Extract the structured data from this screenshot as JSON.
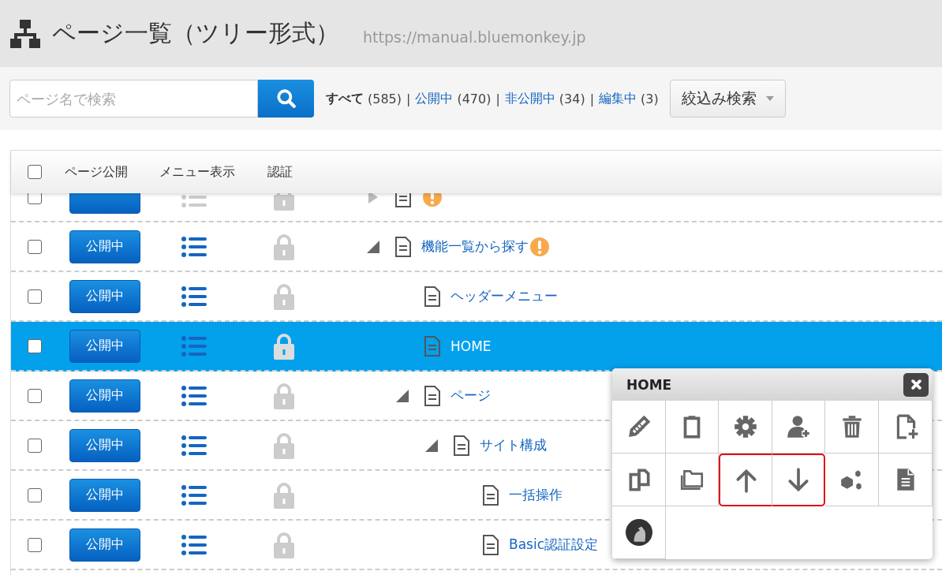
{
  "window": {
    "title": "ページ一覧（ツリー形式）",
    "url": "https://manual.bluemonkey.jp"
  },
  "search": {
    "placeholder": "ページ名で検索"
  },
  "filters": [
    {
      "label": "すべて",
      "count": "(585)",
      "selected": true
    },
    {
      "separator": "|",
      "label": "公開中",
      "count": "(470)",
      "selected": false
    },
    {
      "separator": "|",
      "label": "非公開中",
      "count": "(34)",
      "selected": false
    },
    {
      "separator": "|",
      "label": "編集中",
      "count": "(3)",
      "selected": false
    }
  ],
  "filter_dropdown": {
    "label": "絞込み検索"
  },
  "table": {
    "columns": [
      "ページ公開",
      "メニュー表示",
      "認証"
    ],
    "header_checked": false,
    "rows": [
      {
        "checked": false,
        "menu_shown": false,
        "selected": false,
        "warning": true,
        "expanded": false
      },
      {
        "title": "機能一覧から探す",
        "status": "公開中",
        "checked": false,
        "menu_shown": true,
        "selected": false,
        "warning": true,
        "expanded": true,
        "children": [
          {
            "title": "ヘッダーメニュー",
            "status": "公開中",
            "checked": false,
            "menu_shown": true,
            "selected": false,
            "warning": false
          },
          {
            "title": "HOME",
            "status": "公開中",
            "checked": false,
            "menu_shown": true,
            "selected": true,
            "warning": false
          },
          {
            "title": "ページ",
            "status": "公開中",
            "checked": false,
            "menu_shown": true,
            "selected": false,
            "warning": false,
            "expanded": true,
            "children": [
              {
                "title": "サイト構成",
                "status": "公開中",
                "checked": false,
                "menu_shown": true,
                "selected": false,
                "warning": false,
                "expanded": true,
                "children": [
                  {
                    "title": "一括操作",
                    "status": "公開中",
                    "checked": false,
                    "menu_shown": true,
                    "selected": false,
                    "warning": false
                  },
                  {
                    "title": "Basic認証設定",
                    "status": "公開中",
                    "checked": false,
                    "menu_shown": true,
                    "selected": false,
                    "warning": false
                  }
                ]
              }
            ]
          }
        ]
      }
    ]
  },
  "popup": {
    "title": "HOME",
    "actions": [
      {
        "kind": "pencil",
        "highlighted": false
      },
      {
        "kind": "clipboard",
        "highlighted": false
      },
      {
        "kind": "gear",
        "highlighted": false
      },
      {
        "kind": "user-add",
        "highlighted": false
      },
      {
        "kind": "trash",
        "highlighted": false
      },
      {
        "kind": "file-add",
        "highlighted": false
      },
      {
        "kind": "copy",
        "highlighted": false
      },
      {
        "kind": "folders",
        "highlighted": false
      },
      {
        "kind": "arrow-up",
        "highlighted": true
      },
      {
        "kind": "arrow-down",
        "highlighted": true
      },
      {
        "kind": "cubes",
        "highlighted": false
      },
      {
        "kind": "document",
        "highlighted": false
      },
      {
        "kind": "avatar",
        "highlighted": false
      }
    ]
  }
}
